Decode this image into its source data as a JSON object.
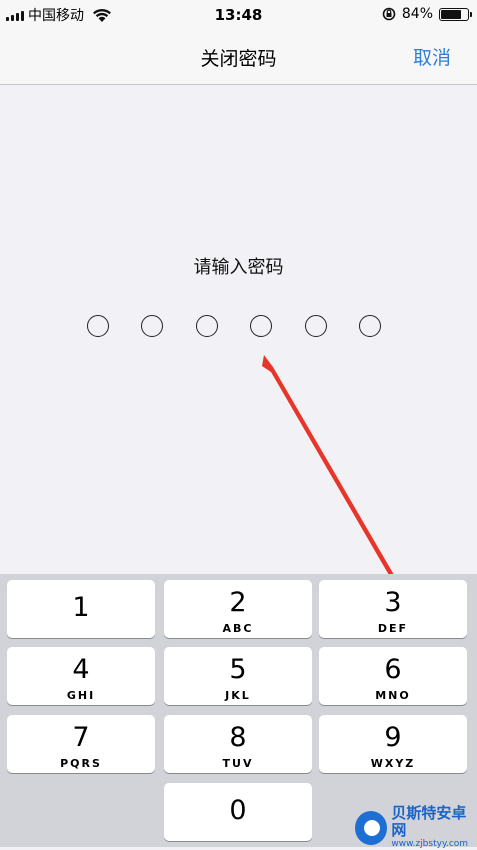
{
  "status_bar": {
    "carrier": "中国移动",
    "time": "13:48",
    "battery_percent": "84%",
    "battery_level": 0.84,
    "icons": [
      "signal-icon",
      "wifi-icon",
      "rotation-lock-icon",
      "battery-icon"
    ]
  },
  "nav": {
    "title": "关闭密码",
    "cancel_label": "取消"
  },
  "passcode": {
    "prompt": "请输入密码",
    "dot_count": 6
  },
  "keypad": {
    "keys": [
      {
        "digit": "1",
        "letters": ""
      },
      {
        "digit": "2",
        "letters": "ABC"
      },
      {
        "digit": "3",
        "letters": "DEF"
      },
      {
        "digit": "4",
        "letters": "GHI"
      },
      {
        "digit": "5",
        "letters": "JKL"
      },
      {
        "digit": "6",
        "letters": "MNO"
      },
      {
        "digit": "7",
        "letters": "PQRS"
      },
      {
        "digit": "8",
        "letters": "TUV"
      },
      {
        "digit": "9",
        "letters": "WXYZ"
      },
      {
        "digit": "0",
        "letters": ""
      }
    ]
  },
  "annotation": {
    "arrow_color": "#e8352a"
  },
  "watermark": {
    "name": "贝斯特安卓网",
    "url": "www.zjbstyy.com"
  },
  "colors": {
    "accent": "#2f7fd6",
    "background": "#f2f2f6",
    "keypad_background": "#d1d3d9"
  }
}
